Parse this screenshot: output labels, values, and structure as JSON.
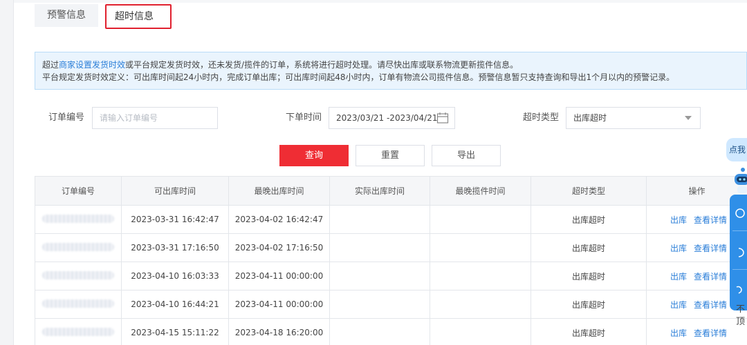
{
  "tabs": [
    {
      "label": "预警信息"
    },
    {
      "label": "超时信息"
    }
  ],
  "notice": {
    "prefix": "超过",
    "link": "商家设置发货时效",
    "line1_rest": "或平台规定发货时效，还未发货/揽件的订单，系统将进行超时处理。请尽快出库或联系物流更新揽件信息。",
    "line2": "平台规定发货时效定义：可出库时间起24小时内，完成订单出库；可出库时间起48小时内，订单有物流公司揽件信息。预警信息暂只支持查询和导出1个月以内的预警记录。"
  },
  "filters": {
    "order_no_label": "订单编号",
    "order_no_placeholder": "请输入订单编号",
    "order_time_label": "下单时间",
    "order_time_value": "2023/03/21 -2023/04/21",
    "timeout_type_label": "超时类型",
    "timeout_type_value": "出库超时"
  },
  "buttons": {
    "query": "查询",
    "reset": "重置",
    "export": "导出"
  },
  "table": {
    "headers": [
      "订单编号",
      "可出库时间",
      "最晚出库时间",
      "实际出库时间",
      "最晚揽件时间",
      "超时类型",
      "操作"
    ],
    "rows": [
      {
        "available": "2023-03-31 16:42:47",
        "latest_out": "2023-04-02 16:42:47",
        "actual_out": "",
        "latest_pickup": "",
        "type": "出库超时",
        "op1": "出库",
        "op2": "查看详情"
      },
      {
        "available": "2023-03-31 17:16:50",
        "latest_out": "2023-04-02 17:16:50",
        "actual_out": "",
        "latest_pickup": "",
        "type": "出库超时",
        "op1": "出库",
        "op2": "查看详情"
      },
      {
        "available": "2023-04-10 16:03:33",
        "latest_out": "2023-04-11 00:00:00",
        "actual_out": "",
        "latest_pickup": "",
        "type": "出库超时",
        "op1": "出库",
        "op2": "查看详情"
      },
      {
        "available": "2023-04-10 16:44:21",
        "latest_out": "2023-04-11 00:00:00",
        "actual_out": "",
        "latest_pickup": "",
        "type": "出库超时",
        "op1": "出库",
        "op2": "查看详情"
      },
      {
        "available": "2023-04-15 15:11:22",
        "latest_out": "2023-04-18 16:20:00",
        "actual_out": "",
        "latest_pickup": "",
        "type": "出库超时",
        "op1": "出库",
        "op2": "查看详情"
      }
    ]
  },
  "floating": {
    "bubble_text": "点我",
    "side_text": "不顶"
  },
  "colors": {
    "primary_red": "#ef2d34",
    "link_blue": "#2a7ed8",
    "notice_bg": "#eaf4fd",
    "float_blue": "#2f8fe8"
  }
}
